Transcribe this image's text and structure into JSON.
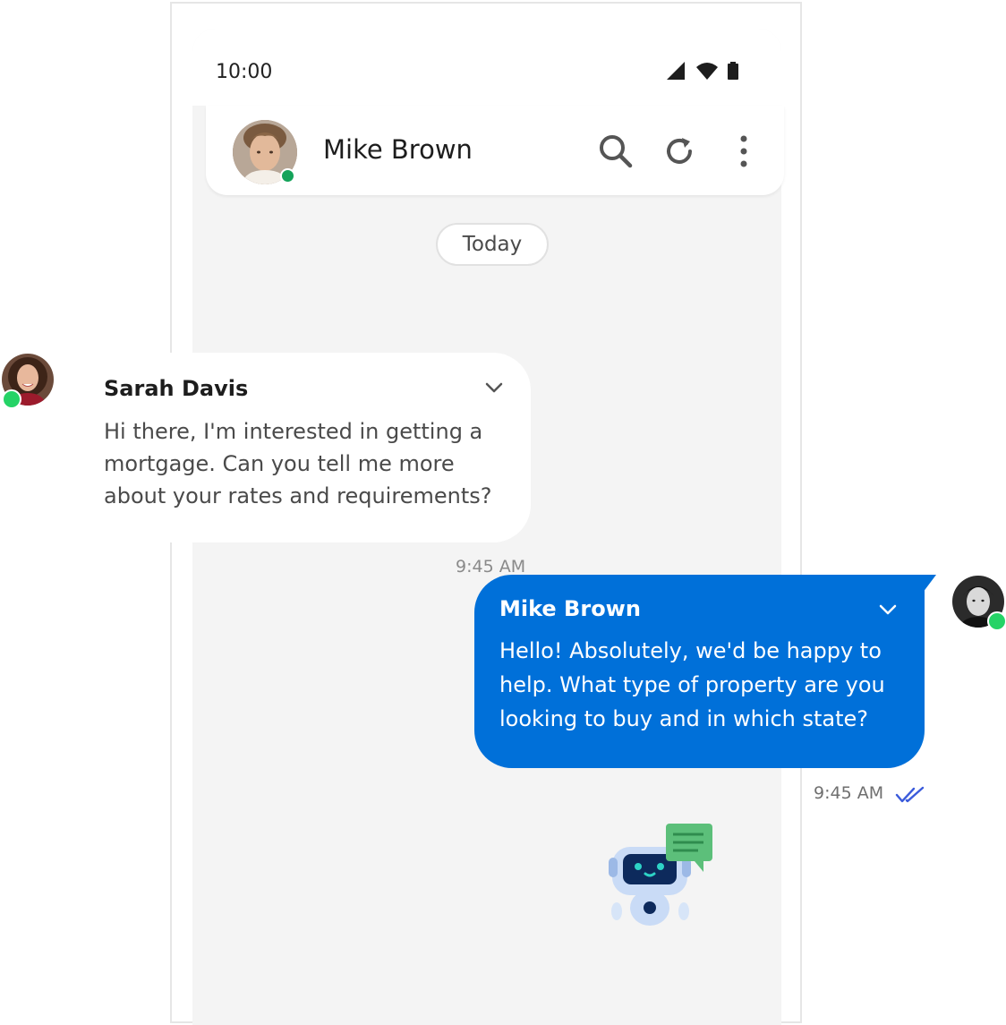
{
  "status_bar": {
    "time": "10:00"
  },
  "header": {
    "contact_name": "Mike Brown",
    "online": true
  },
  "date_separator": "Today",
  "messages": [
    {
      "sender": "Sarah Davis",
      "text": "Hi there, I'm interested in getting a mortgage. Can you tell me more about your rates and requirements?",
      "time": "9:45 AM",
      "direction": "incoming",
      "channel": "whatsapp"
    },
    {
      "sender": "Mike Brown",
      "text": "Hello! Absolutely, we'd be happy to help. What type of property are you looking to buy and in which state?",
      "time": "9:45 AM",
      "direction": "outgoing",
      "channel": "whatsapp",
      "read": true
    }
  ],
  "colors": {
    "outgoing_bubble": "#0070d9",
    "online": "#14a35a",
    "whatsapp": "#25d366",
    "read_ticks": "#3b5bdb"
  },
  "icons": [
    "signal-icon",
    "wifi-icon",
    "battery-icon",
    "search-icon",
    "refresh-icon",
    "more-vertical-icon",
    "chevron-down-icon",
    "whatsapp-icon",
    "double-check-icon",
    "chatbot-illustration"
  ]
}
